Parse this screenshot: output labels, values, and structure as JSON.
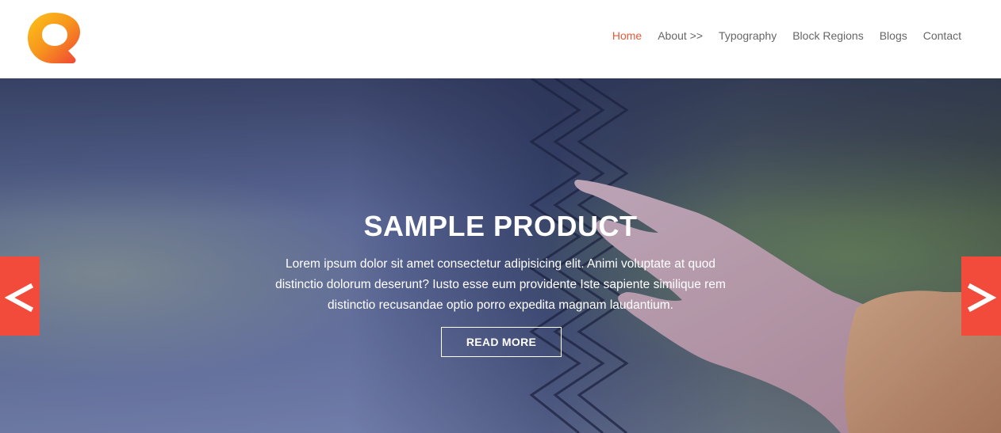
{
  "nav": {
    "items": [
      {
        "label": "Home",
        "active": true
      },
      {
        "label": "About >>",
        "active": false
      },
      {
        "label": "Typography",
        "active": false
      },
      {
        "label": "Block Regions",
        "active": false
      },
      {
        "label": "Blogs",
        "active": false
      },
      {
        "label": "Contact",
        "active": false
      }
    ]
  },
  "hero": {
    "title": "SAMPLE PRODUCT",
    "description": "Lorem ipsum dolor sit amet consectetur adipisicing elit. Animi voluptate at quod distinctio dolorum deserunt? Iusto esse eum providente Iste sapiente similique rem distinctio recusandae optio porro expedita magnam laudantium.",
    "button_label": "READ MORE",
    "prev_icon": "chevron-left-icon",
    "next_icon": "chevron-right-icon"
  },
  "colors": {
    "accent": "#f24b3b",
    "nav_active": "#e55b3c",
    "nav_text": "#666666",
    "logo_orange": "#f7941d",
    "logo_red": "#ef4136"
  }
}
